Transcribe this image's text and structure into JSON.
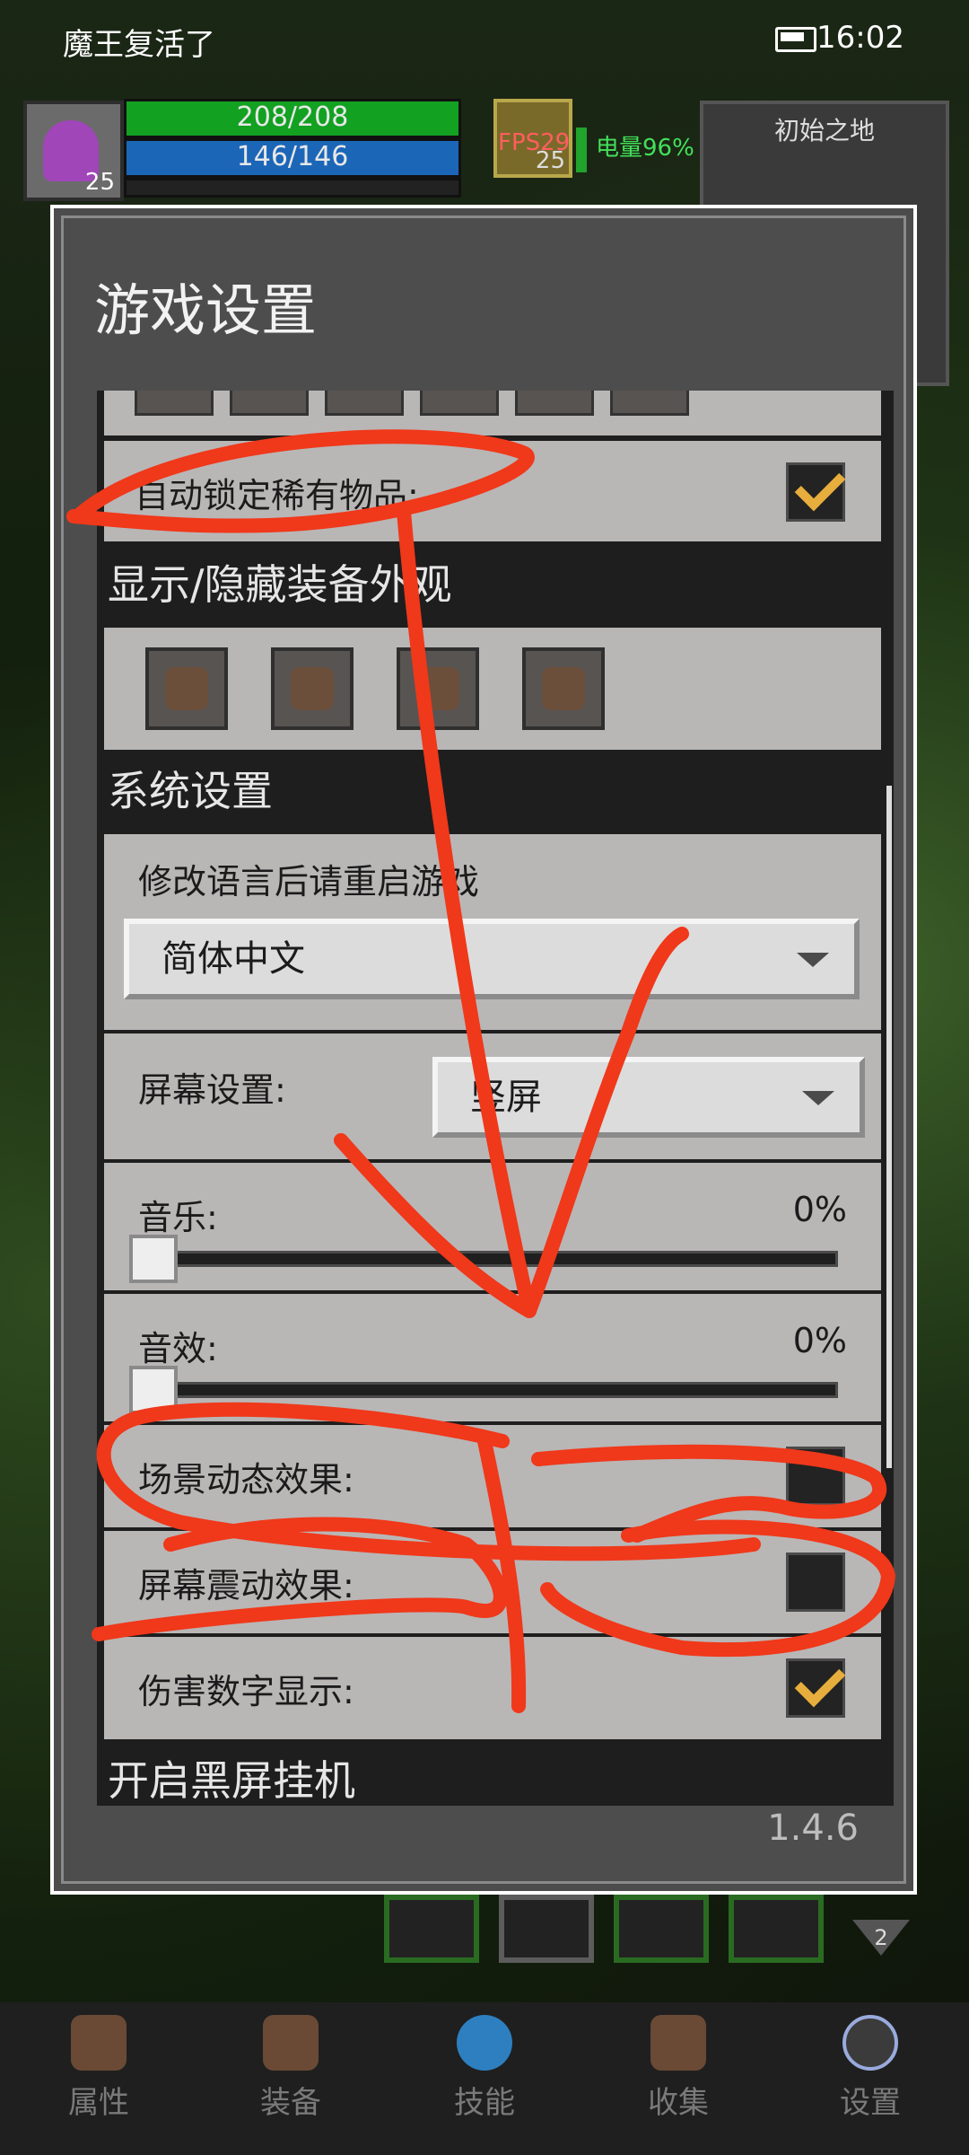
{
  "status_bar": {
    "app_name": "魔王复活了",
    "time": "16:02"
  },
  "hud": {
    "player_level": "25",
    "hp": "208/208",
    "mp": "146/146",
    "pet_level": "25",
    "fps": "FPS29",
    "battery": "电量96%",
    "map_name": "初始之地"
  },
  "dialog": {
    "title": "游戏设置",
    "auto_lock_rare_label": "自动锁定稀有物品:",
    "auto_lock_rare_checked": true,
    "section_display": "显示/隐藏装备外观",
    "section_system": "系统设置",
    "language_hint": "修改语言后请重启游戏",
    "language_value": "简体中文",
    "screen_label": "屏幕设置:",
    "screen_value": "竖屏",
    "music_label": "音乐:",
    "music_value": "0%",
    "sfx_label": "音效:",
    "sfx_value": "0%",
    "scene_fx_label": "场景动态效果:",
    "scene_fx_checked": false,
    "shake_label": "屏幕震动效果:",
    "shake_checked": false,
    "damage_label": "伤害数字显示:",
    "damage_checked": true,
    "section_blackscreen": "开启黑屏挂机",
    "version": "1.4.6"
  },
  "page_indicator": "2",
  "nav": {
    "items": [
      {
        "label": "属性",
        "icon": "helmet-icon"
      },
      {
        "label": "装备",
        "icon": "bag-icon"
      },
      {
        "label": "技能",
        "icon": "skill-gem-icon"
      },
      {
        "label": "收集",
        "icon": "book-icon"
      },
      {
        "label": "设置",
        "icon": "gear-icon"
      }
    ]
  },
  "colors": {
    "annotation_red": "#f0381a",
    "hp": "#13a122",
    "mp": "#1c66b8",
    "check": "#e7ae3d"
  }
}
